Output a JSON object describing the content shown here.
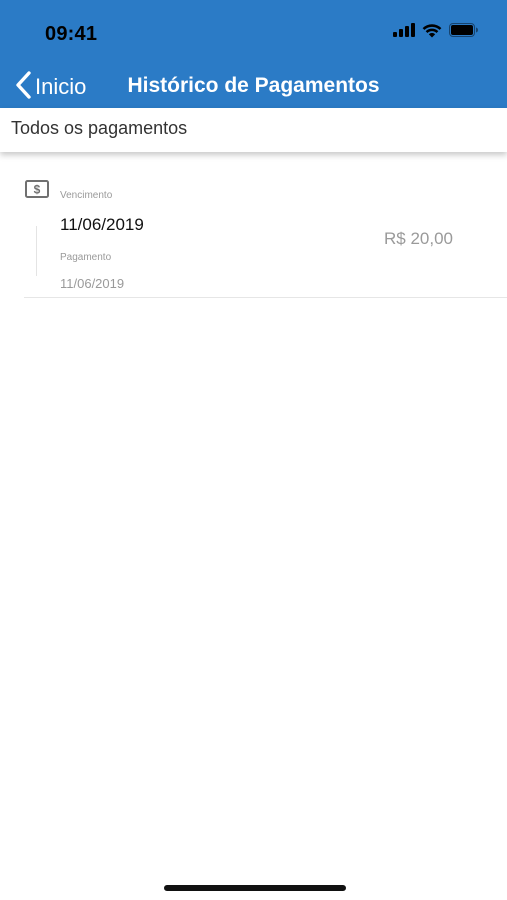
{
  "colors": {
    "brand": "#2b7bc6",
    "muted_text": "#9a9a9a",
    "primary_text": "#111111"
  },
  "status_bar": {
    "time": "09:41",
    "icons": [
      "cellular-signal-icon",
      "wifi-icon",
      "battery-icon"
    ]
  },
  "nav": {
    "back_label": "Inicio",
    "title": "Histórico de Pagamentos"
  },
  "filter": {
    "label": "Todos os pagamentos"
  },
  "payments": [
    {
      "icon": "money-bill-icon",
      "due_caption": "Vencimento",
      "due_date": "11/06/2019",
      "paid_caption": "Pagamento",
      "paid_date": "11/06/2019",
      "amount": "R$ 20,00"
    }
  ]
}
